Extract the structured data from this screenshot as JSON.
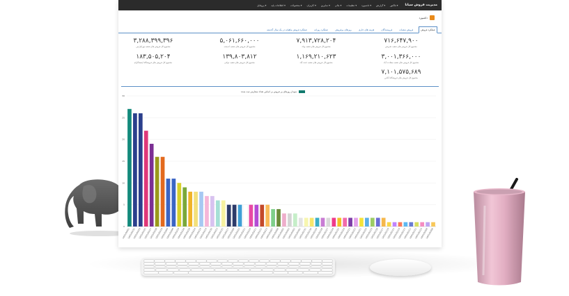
{
  "header": {
    "brand": "مدیریت فروش سیانا",
    "menu": [
      "فاکتور ▾",
      "گزارش ▾",
      "داشبورد ▾",
      "تنظیمات ▾",
      "مالی ▾",
      "سایرین ▾",
      "کاربران ▾",
      "محصولات ▾",
      "اطلاعات پایه ▾",
      "پروفایل ▾"
    ]
  },
  "breadcrumb": {
    "label": "داشبورد"
  },
  "tabs": [
    {
      "label": "عملکرد فروش",
      "active": true
    },
    {
      "label": "فروش شعبات",
      "active": false
    },
    {
      "label": "فروشندگان",
      "active": false
    },
    {
      "label": "هزینه های جاری",
      "active": false
    },
    {
      "label": "روزهای پرفروش",
      "active": false
    },
    {
      "label": "عملکرد روزانه",
      "active": false
    },
    {
      "label": "عملکرد فروش ماهیانه در یک سال گذشته",
      "active": false
    }
  ],
  "stats": [
    {
      "value": "۷۱۶,۶۴۷,۹۰۰",
      "label": "مجموع کل فروش های شعبه تجریش"
    },
    {
      "value": "۳,۰۰۱,۳۶۶,۰۰۰",
      "label": "مجموع کل فروش های شعبه سعادت آباد"
    },
    {
      "value": "۷,۱۰۱,۵۷۵,۶۸۹",
      "label": "مجموع کل فروش های فروشگاه آنلاین"
    },
    {
      "value": "۷,۹۱۳,۷۲۸,۲۰۴",
      "label": "مجموع کل فروش های شعبه ونک"
    },
    {
      "value": "۱,۱۶۹,۲۱۰,۶۲۳",
      "label": "مجموع کل فروش های شعبه جنت آباد"
    },
    {
      "value": "۵,۰۶۱,۶۶۰,۰۰۰",
      "label": "مجموع کل فروش های شعبه اندیشه"
    },
    {
      "value": "۱۳۹,۸۰۳,۸۱۲",
      "label": "مجموع کل فروش های شعبه دولتی"
    },
    {
      "value": "۳,۲۸۸,۳۹۹,۳۹۶",
      "label": "مجموع کل فروش های شعبه تهرانپارس"
    },
    {
      "value": "۱۸۳,۵۰۵,۲۰۴",
      "label": "مجموع کل فروش های فروشگاه اینستاگرام"
    }
  ],
  "colors": {
    "legend": "#117a6e",
    "accent": "#5b8fc7",
    "navbar": "#2b2b2b"
  },
  "chart_data": {
    "type": "bar",
    "title": "",
    "legend": "نمودار روزهای پر فروش بر اساس تعداد سفارش ثبت شده",
    "ylim": [
      0,
      30
    ],
    "yticks": [
      0,
      5,
      10,
      15,
      20,
      25,
      30
    ],
    "categories": [
      "1401/04/01",
      "1401/03/31",
      "1401/03/29",
      "1401/03/25",
      "1401/03/27",
      "1401/03/28",
      "1401/03/16",
      "1401/03/04",
      "1401/03/06",
      "1401/03/20",
      "1401/03/26",
      "1401/03/18",
      "1401/03/24",
      "1401/03/19",
      "1401/03/14",
      "1401/03/30",
      "1401/03/23",
      "1401/03/15",
      "1401/03/17",
      "1401/03/09",
      "1401/03/22",
      "1401/03/21",
      "1401/03/10",
      "1401/03/11",
      "1401/03/12",
      "1401/03/13",
      "1401/03/07",
      "1401/03/08",
      "1401/03/05",
      "1401/03/03",
      "1401/03/02",
      "1401/03/01",
      "1401/02/31",
      "1401/02/30",
      "1401/02/29",
      "1401/02/28",
      "1401/02/27",
      "1401/02/26",
      "1401/02/25",
      "1401/02/24",
      "1401/02/23",
      "1401/02/22",
      "1401/02/21",
      "1401/02/20",
      "1401/02/19",
      "1401/02/18",
      "1401/02/17",
      "1401/02/16",
      "1401/02/15",
      "1401/02/14",
      "1401/02/13",
      "1401/02/12",
      "1401/02/11",
      "1401/02/10",
      "1401/02/09",
      "1401/02/08"
    ],
    "values": [
      27,
      26,
      26,
      22,
      19,
      16,
      16,
      11,
      11,
      10,
      9,
      8,
      8,
      8,
      7,
      7,
      6,
      6,
      5,
      5,
      5,
      5,
      5,
      5,
      5,
      5,
      4,
      4,
      3,
      3,
      3,
      2,
      2,
      2,
      2,
      2,
      2,
      2,
      2,
      2,
      2,
      2,
      2,
      2,
      2,
      2,
      2,
      1,
      1,
      1,
      1,
      1,
      1,
      1,
      1,
      1
    ],
    "colors": [
      "#138a7c",
      "#2b3f8c",
      "#2b3f8c",
      "#e0387a",
      "#7b2f93",
      "#9a9a1c",
      "#e36a1e",
      "#3b65c4",
      "#3b65c4",
      "#d7d02b",
      "#7aa83a",
      "#f0b428",
      "#f3e07a",
      "#a7c8f2",
      "#f6b6d8",
      "#d8c2f0",
      "#a6e0d6",
      "#f6f1a0",
      "#2d3b6a",
      "#2d3b6a",
      "#3f9fd6",
      "#ffffff",
      "#e84aa4",
      "#b44bd4",
      "#c44a2a",
      "#f9bb5a",
      "#7fcf8a",
      "#6b8c3a",
      "#eeaecb",
      "#d4d4d4",
      "#c6eec9",
      "#e3e3e3",
      "#f7f6b0",
      "#f7e66a",
      "#3aaec6",
      "#c87cd4",
      "#d9d9d9",
      "#ef3b8a",
      "#f2c026",
      "#f26baa",
      "#7e3fa8",
      "#e2a2ea",
      "#f4e33a",
      "#5ab0e8",
      "#9ccc64",
      "#6c6cd6",
      "#f5b84c",
      "#f7d74a",
      "#c084fc",
      "#fb7a5b",
      "#5db8f0",
      "#6a7dd2",
      "#d6de60",
      "#f58cc1",
      "#bda4f2",
      "#f8c85a"
    ]
  }
}
